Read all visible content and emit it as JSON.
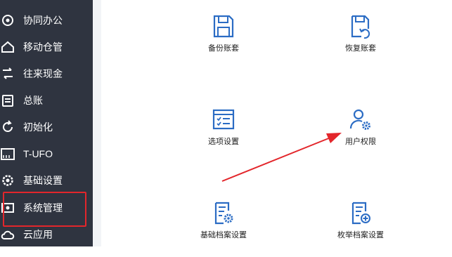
{
  "sidebar": {
    "items": [
      {
        "label": "协同办公",
        "icon": "collab-icon"
      },
      {
        "label": "移动仓管",
        "icon": "mobile-warehouse-icon"
      },
      {
        "label": "往来现金",
        "icon": "cash-icon"
      },
      {
        "label": "总账",
        "icon": "ledger-icon"
      },
      {
        "label": "初始化",
        "icon": "refresh-icon"
      },
      {
        "label": "T-UFO",
        "icon": "ufo-icon"
      },
      {
        "label": "基础设置",
        "icon": "settings-icon"
      },
      {
        "label": "系统管理",
        "icon": "system-admin-icon"
      },
      {
        "label": "云应用",
        "icon": "cloud-icon"
      }
    ]
  },
  "tiles": [
    {
      "label": "备份账套",
      "icon": "backup-icon"
    },
    {
      "label": "恢复账套",
      "icon": "restore-icon"
    },
    {
      "label": "选项设置",
      "icon": "options-icon"
    },
    {
      "label": "用户权限",
      "icon": "user-permission-icon"
    },
    {
      "label": "基础档案设置",
      "icon": "archive-settings-icon"
    },
    {
      "label": "枚举档案设置",
      "icon": "enum-archive-icon"
    }
  ],
  "colors": {
    "sidebar_bg": "#2f3440",
    "icon_blue": "#2b6cc4",
    "highlight_red": "#e3262b"
  }
}
